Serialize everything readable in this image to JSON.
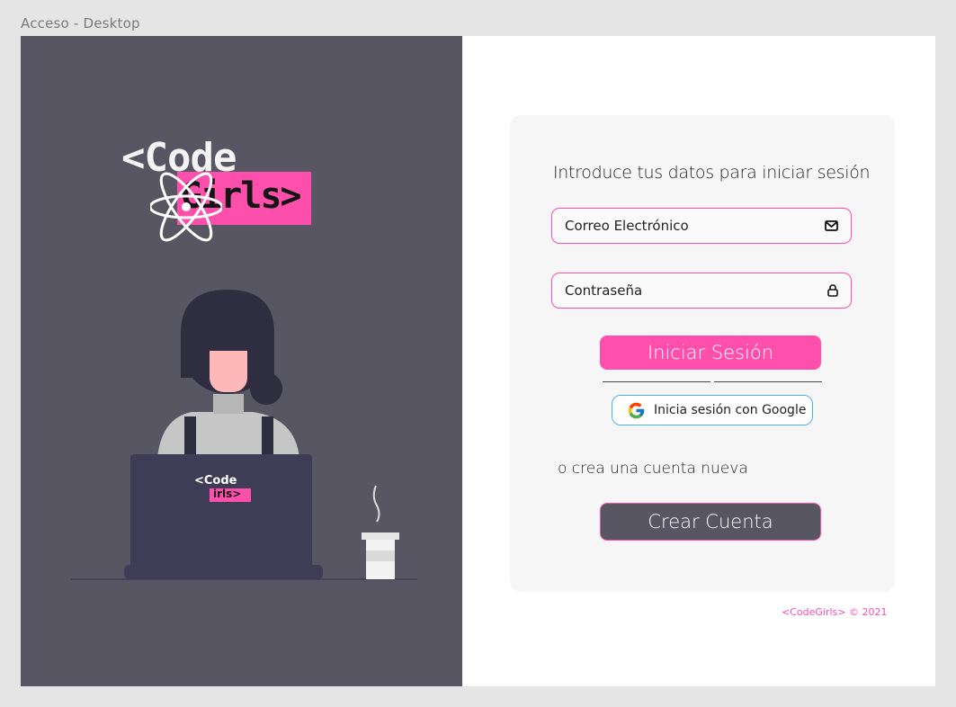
{
  "frame_label": "Acceso - Desktop",
  "logo": {
    "line1": "<Code",
    "line2": "Girls>"
  },
  "laptop_logo": {
    "line1": "<Code",
    "line2": "irls>"
  },
  "login": {
    "heading": "Introduce tus datos para iniciar sesión",
    "email_placeholder": "Correo Electrónico",
    "email_icon": "envelope-icon",
    "password_placeholder": "Contraseña",
    "password_icon": "lock-icon",
    "login_button": "Iniciar Sesión",
    "google_button": "Inicia sesión con Google",
    "create_prompt": "o crea una cuenta nueva",
    "create_button": "Crear Cuenta"
  },
  "footer": "<CodeGirls> © 2021",
  "colors": {
    "accent": "#ff4fac",
    "panel": "#575662",
    "card": "#f6f6f6",
    "google_border": "#4ab3f0"
  }
}
